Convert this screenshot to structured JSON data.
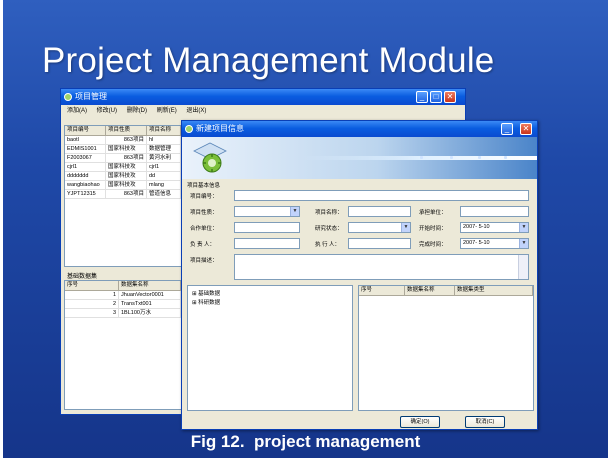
{
  "slide": {
    "title": "Project Management Module",
    "caption": "Fig 12.  project management"
  },
  "back_window": {
    "title": "项目管理",
    "menu": [
      "添加(A)",
      "修改(U)",
      "删除(D)",
      "刷新(E)",
      "退出(X)"
    ],
    "project_table": {
      "columns": [
        "项目编号",
        "项目性质",
        "项目名称"
      ],
      "rows": [
        [
          "baotl",
          "863项目",
          "hl"
        ],
        [
          "EDMIS1001",
          "国家科技攻",
          "数据管理"
        ],
        [
          "F2003067",
          "863项目",
          "黄河水利"
        ],
        [
          "cjrl1",
          "国家科技攻",
          "cjrl1"
        ],
        [
          "ddddddd",
          "国家科技攻",
          "dd"
        ],
        [
          "wangbiaohao",
          "国家科技攻",
          "mlang"
        ],
        [
          "YJPT12315",
          "863项目",
          "管道信息"
        ]
      ]
    },
    "dataset_panel_title": "基础数据集",
    "dataset_table": {
      "columns": [
        "序号",
        "数据集名称"
      ],
      "rows": [
        [
          "1",
          "JhuanVector0001"
        ],
        [
          "2",
          "TransTxt001"
        ],
        [
          "3",
          "1BL100万水"
        ]
      ]
    },
    "controls": {
      "minimize": "_",
      "maximize": "□",
      "close": "✕"
    }
  },
  "front_window": {
    "title": "新建项目信息",
    "group_title": "项目基本信息",
    "labels": {
      "project_no": "项目编号：",
      "project_type": "项目性质：",
      "project_name": "项目名称：",
      "undertaker": "承担单位：",
      "partner": "合作单位：",
      "research_status": "研究状态：",
      "start_time": "开始时间：",
      "leader": "负 责 人：",
      "executor": "执 行 人：",
      "finish_time": "完成时间：",
      "description": "项目描述："
    },
    "values": {
      "start_time": "2007- 5-10",
      "finish_time": "2007- 5-10"
    },
    "tree": [
      "基础数据",
      "科研数据"
    ],
    "dataset_columns": [
      "序号",
      "数据集名称",
      "数据集类型"
    ],
    "buttons": {
      "ok": "确定(O)",
      "cancel": "取消(C)"
    },
    "controls": {
      "minimize": "_",
      "close": "✕"
    }
  },
  "colors": {
    "slide_background": "#1f49a8",
    "xp_title_blue": "#0a5de0",
    "window_face": "#ece9d8",
    "close_red": "#c9331a"
  }
}
